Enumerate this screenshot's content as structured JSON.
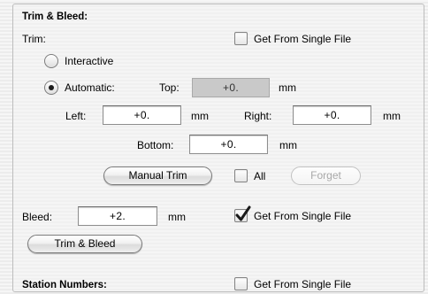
{
  "trim_bleed": {
    "section_title": "Trim & Bleed:",
    "trim_label": "Trim:",
    "trim_get_from_single_file": {
      "label": "Get From Single File",
      "checked": false
    },
    "interactive_label": "Interactive",
    "automatic_label": "Automatic:",
    "mode_selected": "automatic",
    "top": {
      "label": "Top:",
      "value": "+0.",
      "unit": "mm",
      "enabled": false
    },
    "left": {
      "label": "Left:",
      "value": "+0.",
      "unit": "mm"
    },
    "right": {
      "label": "Right:",
      "value": "+0.",
      "unit": "mm"
    },
    "bottom": {
      "label": "Bottom:",
      "value": "+0.",
      "unit": "mm"
    },
    "manual_trim_button": "Manual Trim",
    "all_checkbox": {
      "label": "All",
      "checked": false
    },
    "forget_button": {
      "label": "Forget",
      "enabled": false
    },
    "bleed": {
      "label": "Bleed:",
      "value": "+2.",
      "unit": "mm"
    },
    "bleed_get_from_single_file": {
      "label": "Get From Single File",
      "checked": true
    },
    "trim_and_bleed_button": "Trim & Bleed"
  },
  "station_numbers": {
    "section_title": "Station Numbers:",
    "get_from_single_file": {
      "label": "Get From Single File",
      "checked": false
    }
  }
}
